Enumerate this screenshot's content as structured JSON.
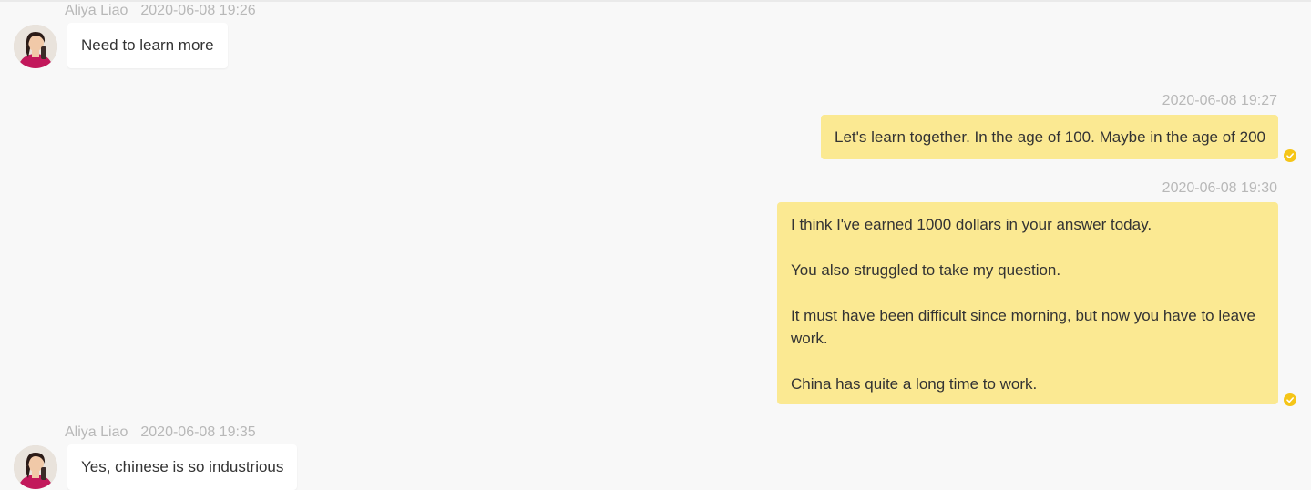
{
  "messages": [
    {
      "direction": "incoming",
      "sender": "Aliya Liao",
      "time": "2020-06-08 19:26",
      "text": "Need to learn more"
    },
    {
      "direction": "outgoing",
      "time": "2020-06-08 19:27",
      "text": "Let's learn together. In the age of 100. Maybe in the age of 200",
      "status": "read"
    },
    {
      "direction": "outgoing",
      "time": "2020-06-08 19:30",
      "paragraphs": [
        "I think I've earned 1000 dollars in your answer today.",
        "You also struggled to take my question.",
        "It must have been difficult since morning, but now you have to leave work.",
        "China has quite a long time to work."
      ],
      "status": "read"
    },
    {
      "direction": "incoming",
      "sender": "Aliya Liao",
      "time": "2020-06-08 19:35",
      "text": "Yes, chinese is so industrious"
    }
  ],
  "colors": {
    "background": "#f8f8f8",
    "incoming_bubble": "#ffffff",
    "outgoing_bubble": "#fbe992",
    "meta_text": "#b8b8b8",
    "message_text": "#333333",
    "read_check": "#f5c518"
  },
  "icons": {
    "read_status": "check-circle-icon",
    "avatar": "user-avatar-photo"
  }
}
